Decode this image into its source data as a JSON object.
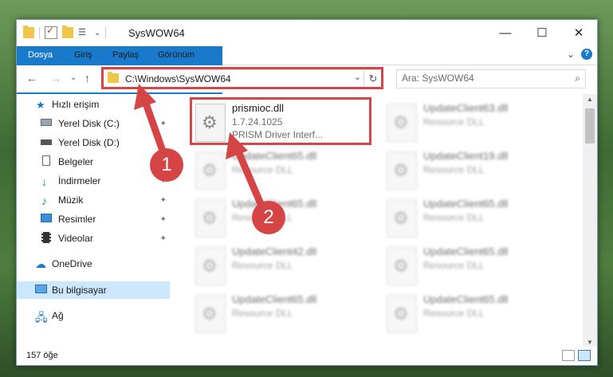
{
  "window": {
    "title": "SysWOW64",
    "controls": {
      "minimize": "—",
      "maximize": "☐",
      "close": "✕"
    }
  },
  "ribbon": {
    "tabs": [
      "Dosya",
      "Giriş",
      "Paylaş",
      "Görünüm"
    ],
    "expand": "⌄",
    "help": "?"
  },
  "nav": {
    "back": "←",
    "forward": "→",
    "recent": "⌄",
    "up": "↑",
    "address": "C:\\Windows\\SysWOW64",
    "address_dropdown": "⌄",
    "refresh": "↻",
    "search_placeholder": "Ara: SysWOW64",
    "search_icon": "⌕"
  },
  "sidebar": {
    "items": [
      {
        "label": "Hızlı erişim",
        "icon": "star-icon",
        "pinned": false
      },
      {
        "label": "Yerel Disk (C:)",
        "icon": "drive-icon",
        "pinned": true
      },
      {
        "label": "Yerel Disk (D:)",
        "icon": "drive-icon",
        "pinned": false
      },
      {
        "label": "Belgeler",
        "icon": "document-icon",
        "pinned": false
      },
      {
        "label": "İndirmeler",
        "icon": "download-icon",
        "pinned": true
      },
      {
        "label": "Müzik",
        "icon": "music-icon",
        "pinned": true
      },
      {
        "label": "Resimler",
        "icon": "picture-icon",
        "pinned": true
      },
      {
        "label": "Videolar",
        "icon": "video-icon",
        "pinned": true
      },
      {
        "label": "OneDrive",
        "icon": "cloud-icon",
        "pinned": false
      },
      {
        "label": "Bu bilgisayar",
        "icon": "computer-icon",
        "pinned": false,
        "selected": true
      },
      {
        "label": "Ağ",
        "icon": "network-icon",
        "pinned": false
      }
    ],
    "pin_glyph": "📌"
  },
  "files": {
    "highlighted": {
      "name": "prismioc.dll",
      "version": "1.7.24.1025",
      "desc": "PRISM Driver Interf..."
    },
    "blurred": [
      {
        "name": "UpdateClient63.dll",
        "desc": "Resource DLL"
      },
      {
        "name": "UpdateClient65.dll",
        "desc": "Resource DLL"
      },
      {
        "name": "UpdateClient19.dll",
        "desc": "Resource DLL"
      },
      {
        "name": "UpdateClient65.dll",
        "desc": "Resource DLL"
      },
      {
        "name": "UpdateClient65.dll",
        "desc": "Resource DLL"
      },
      {
        "name": "UpdateClient42.dll",
        "desc": "Resource DLL"
      },
      {
        "name": "UpdateClient65.dll",
        "desc": "Resource DLL"
      },
      {
        "name": "UpdateClient65.dll",
        "desc": "Resource DLL"
      },
      {
        "name": "UpdateClient65.dll",
        "desc": "Resource DLL"
      }
    ]
  },
  "status": {
    "count": "157 öğe"
  },
  "annotations": {
    "step1": "1",
    "step2": "2",
    "color": "#d64545"
  }
}
